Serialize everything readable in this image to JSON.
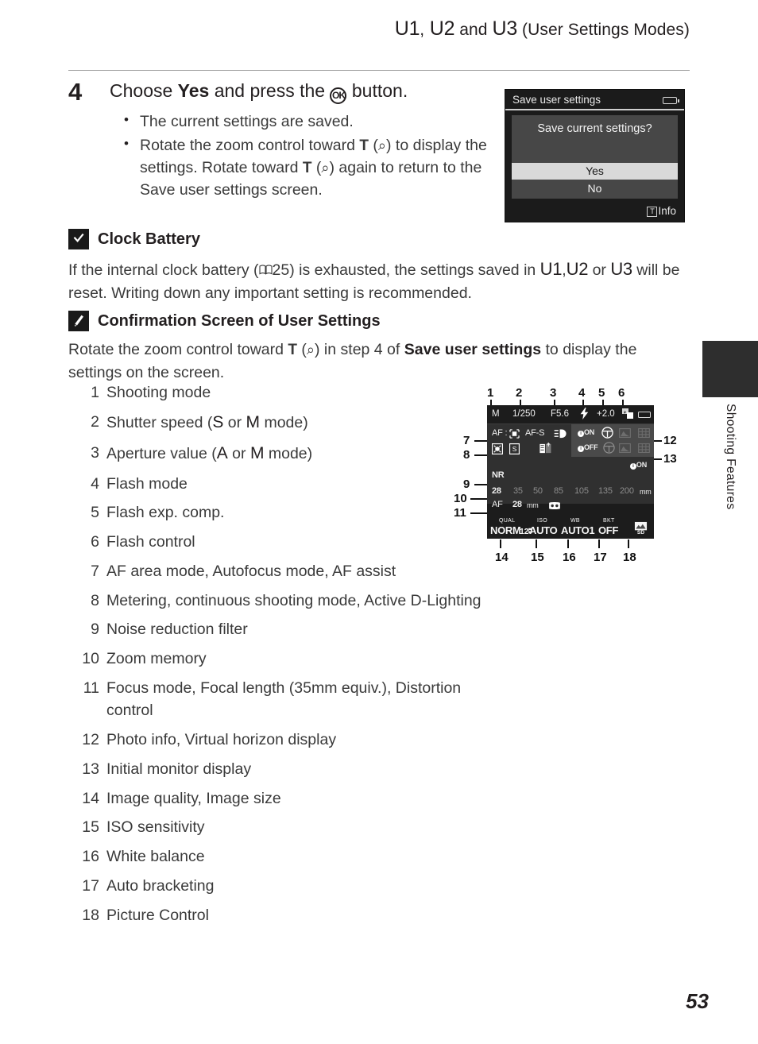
{
  "header": {
    "u1": "U1",
    "comma1": ",",
    "u2": "U2",
    "and": " and ",
    "u3": "U3",
    "suffix": " (User Settings Modes)"
  },
  "step": {
    "number": "4",
    "title_pre": "Choose ",
    "title_bold": "Yes",
    "title_mid": " and press the ",
    "ok_icon": "OK",
    "title_post": " button.",
    "bullets": [
      "The current settings are saved.",
      "Rotate the zoom control toward T (Q) to display the settings. Rotate toward T (Q) again to return to the Save user settings screen."
    ],
    "bullet2_parts": {
      "p1": "Rotate the zoom control toward ",
      "t1": "T",
      "p2": " (",
      "mag1": "⌕",
      "p3": ") to display the settings. Rotate toward ",
      "t2": "T",
      "p4": " (",
      "mag2": "⌕",
      "p5": ") again to return to the Save user settings screen."
    }
  },
  "camera_screen": {
    "title": "Save user settings",
    "battery_icon": "battery-icon",
    "question": "Save current settings?",
    "yes": "Yes",
    "no": "No",
    "footer_key": "T",
    "footer_label": "Info"
  },
  "note_clock": {
    "icon": "caution-icon",
    "title": "Clock Battery",
    "text_p1": "If the internal clock battery (",
    "book_icon": "📖",
    "text_page": "25",
    "text_p2": ") is exhausted, the settings saved in ",
    "u1": "U1",
    "comma": ",",
    "u2": "U2",
    "or": " or ",
    "u3": "U3",
    "text_p3": " will be reset. Writing down any important setting is recommended."
  },
  "note_confirm": {
    "icon": "pencil-note-icon",
    "title": "Confirmation Screen of User Settings",
    "text_p1": "Rotate the zoom control toward ",
    "t": "T",
    "text_p2": " (",
    "mag": "⌕",
    "text_p3": ") in step 4 of ",
    "bold": "Save user settings",
    "text_p4": " to display the settings on the screen."
  },
  "items": [
    {
      "n": "1",
      "parts": [
        {
          "t": "Shooting mode"
        }
      ]
    },
    {
      "n": "2",
      "parts": [
        {
          "t": "Shutter speed ("
        },
        {
          "t": "S",
          "mode": true
        },
        {
          "t": " or "
        },
        {
          "t": "M",
          "mode": true
        },
        {
          "t": " mode)"
        }
      ]
    },
    {
      "n": "3",
      "parts": [
        {
          "t": "Aperture value ("
        },
        {
          "t": "A",
          "mode": true
        },
        {
          "t": " or "
        },
        {
          "t": "M",
          "mode": true
        },
        {
          "t": " mode)"
        }
      ]
    },
    {
      "n": "4",
      "parts": [
        {
          "t": "Flash mode"
        }
      ]
    },
    {
      "n": "5",
      "parts": [
        {
          "t": "Flash exp. comp."
        }
      ]
    },
    {
      "n": "6",
      "parts": [
        {
          "t": "Flash control"
        }
      ]
    },
    {
      "n": "7",
      "parts": [
        {
          "t": "AF area mode, Autofocus mode, AF assist"
        }
      ]
    },
    {
      "n": "8",
      "parts": [
        {
          "t": "Metering, continuous shooting mode, Active D-Lighting"
        }
      ]
    },
    {
      "n": "9",
      "parts": [
        {
          "t": "Noise reduction filter"
        }
      ]
    },
    {
      "n": "10",
      "parts": [
        {
          "t": "Zoom memory"
        }
      ]
    },
    {
      "n": "11",
      "parts": [
        {
          "t": "Focus mode, Focal length (35mm equiv.), Distortion control"
        }
      ]
    },
    {
      "n": "12",
      "parts": [
        {
          "t": "Photo info, Virtual horizon display"
        }
      ]
    },
    {
      "n": "13",
      "parts": [
        {
          "t": "Initial monitor display"
        }
      ]
    },
    {
      "n": "14",
      "parts": [
        {
          "t": "Image quality, Image size"
        }
      ]
    },
    {
      "n": "15",
      "parts": [
        {
          "t": "ISO sensitivity"
        }
      ]
    },
    {
      "n": "16",
      "parts": [
        {
          "t": "White balance"
        }
      ]
    },
    {
      "n": "17",
      "parts": [
        {
          "t": "Auto bracketing"
        }
      ]
    },
    {
      "n": "18",
      "parts": [
        {
          "t": "Picture Control"
        }
      ]
    }
  ],
  "monitor_diagram": {
    "callouts_top": [
      "1",
      "2",
      "3",
      "4",
      "5",
      "6"
    ],
    "callouts_left": [
      "7",
      "8",
      "9",
      "10",
      "11"
    ],
    "callouts_right": [
      "12",
      "13"
    ],
    "callouts_bottom": [
      "14",
      "15",
      "16",
      "17",
      "18"
    ],
    "row1": {
      "mode": "M",
      "shutter": "1/250",
      "aperture": "F5.6",
      "flash_icon": "flash-icon",
      "flash_comp": "+2.0",
      "flash_control_icon": "flash-control-icon",
      "battery_icon": "battery-icon"
    },
    "af_line": {
      "af_label": "AF :",
      "af_area_icon": "af-area-icon",
      "af_mode": "AF-S",
      "af_assist_icon": "af-assist-icon"
    },
    "metering_line": {
      "metering_icon": "matrix-metering-icon",
      "continuous_icon": "single-shot-icon",
      "adl_icon": "active-d-lighting-icon"
    },
    "photo_info": {
      "row1_label": "ON",
      "row2_label": "OFF",
      "horizon_icon": "virtual-horizon-icon",
      "histogram_icon": "histogram-icon",
      "grid_icon": "framing-grid-icon"
    },
    "initial_monitor": "ON",
    "nr_filter": "NR",
    "zoom_memory": {
      "active": "28",
      "steps": [
        "35",
        "50",
        "85",
        "105",
        "135",
        "200"
      ],
      "unit": "mm"
    },
    "focus_row": {
      "focus_mode": "AF",
      "focal_length": "28",
      "unit": "mm",
      "distortion_icon": "distortion-control-icon"
    },
    "bottom_row": [
      {
        "label": "QUAL",
        "value": "NORM",
        "icon": "image-size-icon"
      },
      {
        "label": "ISO",
        "value": "AUTO",
        "icon": ""
      },
      {
        "label": "WB",
        "value": "AUTO1",
        "icon": ""
      },
      {
        "label": "BKT",
        "value": "OFF",
        "icon": ""
      },
      {
        "label": "",
        "value": "",
        "icon": "picture-control-icon"
      }
    ]
  },
  "side_tab": {
    "label": "Shooting Features"
  },
  "page_number": "53"
}
